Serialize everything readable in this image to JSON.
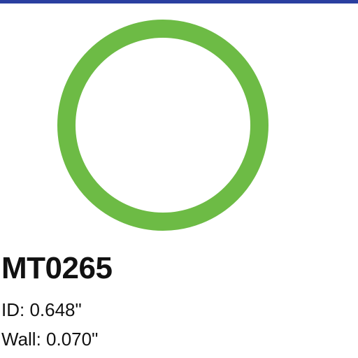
{
  "colors": {
    "top_bar": "#2a3fa0",
    "ring": "#6dbb45"
  },
  "product": {
    "icon": "o-ring-icon",
    "part_number": "MT0265",
    "specs": [
      {
        "text": "ID: 0.648\""
      },
      {
        "text": "Wall: 0.070\""
      }
    ]
  }
}
